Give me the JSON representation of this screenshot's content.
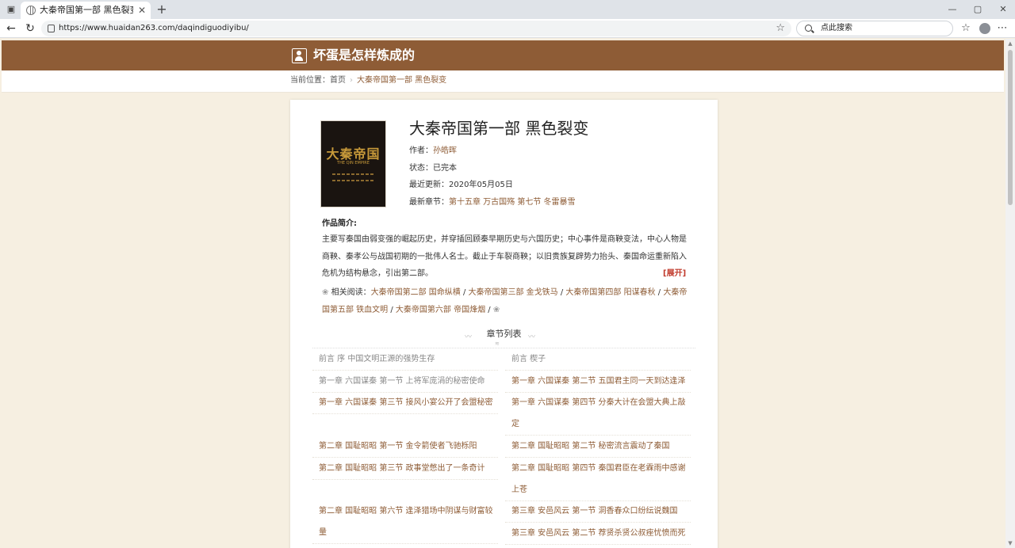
{
  "browser": {
    "tab_title": "大秦帝国第一部 黑色裂变全文阅读",
    "url": "https://www.huaidan263.com/daqindiguodiyibu/",
    "search_placeholder": "点此搜索"
  },
  "site": {
    "title": "坏蛋是怎样炼成的"
  },
  "breadcrumb": {
    "label": "当前位置：",
    "home": "首页",
    "current": "大秦帝国第一部 黑色裂变"
  },
  "book": {
    "title": "大秦帝国第一部 黑色裂变",
    "author_label": "作者：",
    "author": "孙皓晖",
    "status_label": "状态：",
    "status": "已完本",
    "updated_label": "最近更新：",
    "updated": "2020年05月05日",
    "latest_label": "最新章节：",
    "latest": "第十五章 万古国殇 第七节 冬雷暴雪",
    "cover_title": "大秦帝国",
    "cover_sub": "THE QIN EMPIRE"
  },
  "intro": {
    "heading": "作品简介:",
    "text": "主要写秦国由弱变强的崛起历史，并穿插回顾秦早期历史与六国历史；中心事件是商鞅变法，中心人物是商鞅、秦孝公与战国初期的一批伟人名士。截止于车裂商鞅；以旧贵族复辟势力抬头、秦国命运重新陷入危机为结构悬念，引出第二部。",
    "expand": "[展开]"
  },
  "related": {
    "label": "相关阅读：",
    "items": [
      "大秦帝国第二部 国命纵横",
      "大秦帝国第三部 金戈铁马",
      "大秦帝国第四部 阳谋春秋",
      "大秦帝国第五部 铁血文明",
      "大秦帝国第六部 帝国烽烟"
    ],
    "separator": " / "
  },
  "chapter_list": {
    "title": "章节列表",
    "items": [
      "前言 序 中国文明正源的强势生存",
      "前言 楔子",
      "第一章 六国谋秦 第一节 上将军庞涓的秘密使命",
      "第一章 六国谋秦 第二节 五国君主同一天到达逢泽",
      "第一章 六国谋秦 第三节 接风小宴公开了会盟秘密",
      "第一章 六国谋秦 第四节 分秦大计在会盟大典上敲定",
      "第二章 国耻昭昭 第一节 金令箭使者飞驰栎阳",
      "第二章 国耻昭昭 第二节 秘密流言震动了秦国",
      "第二章 国耻昭昭 第三节 政事堂憋出了一条奇计",
      "第二章 国耻昭昭 第四节 秦国君臣在老霖雨中感谢上苍",
      "第二章 国耻昭昭 第六节 逢泽猎场中阴谋与财富较量",
      "第三章 安邑风云 第一节 洞香春众口纷纭说魏国",
      "第三章 安邑风云 第二节 荐贤杀贤公叔痤忧愤而死"
    ]
  },
  "colors": {
    "header_brown": "#8e5c36",
    "link_brown": "#8e5c36",
    "expand_red": "#c0392b",
    "page_bg": "#f6efe1"
  },
  "icons": {
    "site_logo": "user-portrait-icon",
    "related_marker": "flower-icon"
  }
}
